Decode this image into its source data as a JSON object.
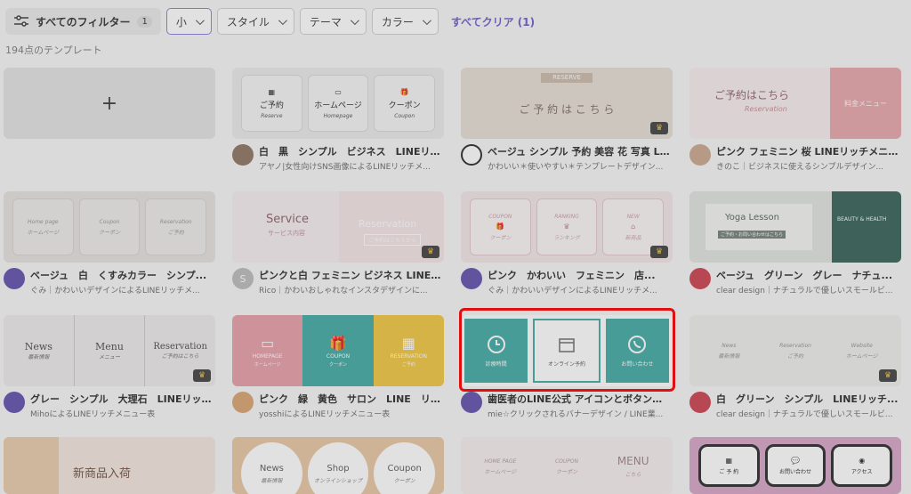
{
  "filters": {
    "all_label": "すべてのフィルター",
    "all_count": "1",
    "chips": [
      {
        "label": "小",
        "selected": true
      },
      {
        "label": "スタイル",
        "selected": false
      },
      {
        "label": "テーマ",
        "selected": false
      },
      {
        "label": "カラー",
        "selected": false
      }
    ],
    "clear_label": "すべてクリア (1)"
  },
  "result_count": "194点のテンプレート",
  "add_symbol": "+",
  "cards": [
    {
      "title": "白　黒　シンプル　ビジネス　LINEリ...",
      "author": "アヤノ|女性向けSNS画像によるLINEリッチメ...",
      "thumb": {
        "items": [
          "ご予約",
          "ホームページ",
          "クーポン"
        ],
        "subs": [
          "Reserve",
          "Homepage",
          "Coupon"
        ]
      }
    },
    {
      "title": "ベージュ シンプル 予約 美容 花 写真 LIN...",
      "author": "かわいい＊使いやすい＊テンプレートデザイン...",
      "thumb": {
        "banner": "RESERVE",
        "text": "ご 予 約 は こ ち ら"
      }
    },
    {
      "title": "ピンク フェミニン 桜 LINEリッチメニ...",
      "author": "きのこ｜ビジネスに使えるシンプルデザイン...",
      "thumb": {
        "text": "ご予約はこちら",
        "sub": "Reservation",
        "side": "料金メニュー"
      }
    },
    {
      "title": "ベージュ　白　くすみカラー　シンプ...",
      "author": "ぐみ｜かわいいデザインによるLINEリッチメ...",
      "thumb": {
        "items": [
          "Home page",
          "Coupon",
          "Reservation"
        ],
        "subs": [
          "ホームページ",
          "クーポン",
          "ご予約"
        ]
      }
    },
    {
      "title": "ピンクと白 フェミニン ビジネス LINE...",
      "author": "Rico｜かわいおしゃれなインスタデザインに...",
      "thumb": {
        "left": "Service",
        "left_sub": "サービス内容",
        "right": "Reservation",
        "right_sub": "ご予約はこちらから"
      }
    },
    {
      "title": "ピンク　かわいい　フェミニン　店...",
      "author": "ぐみ｜かわいいデザインによるLINEリッチメ...",
      "thumb": {
        "items": [
          "COUPON",
          "RANKING",
          "NEW"
        ],
        "subs": [
          "クーポン",
          "ランキング",
          "新商品"
        ]
      }
    },
    {
      "title": "ベージュ　グリーン　グレー　ナチュ...",
      "author": "clear design｜ナチュラルで優しいスモールビ...",
      "thumb": {
        "left": "Yoga Lesson",
        "left_sub": "ご予約・お問い合わせはこちら",
        "right": "BEAUTY & HEALTH"
      }
    },
    {
      "title": "グレー　シンプル　大理石　LINEリッ...",
      "author": "MihoによるLINEリッチメニュー表",
      "thumb": {
        "items": [
          "News",
          "Menu",
          "Reservation"
        ],
        "subs": [
          "最新情報",
          "メニュー",
          "ご予約はこちら"
        ]
      }
    },
    {
      "title": "ピンク　緑　黄色　サロン　LINE　リ...",
      "author": "yosshiによるLINEリッチメニュー表",
      "thumb": {
        "items": [
          "HOMEPAGE",
          "COUPON",
          "RESERVATION"
        ],
        "subs": [
          "ホームページ",
          "クーポン",
          "ご予約"
        ]
      }
    },
    {
      "title": "歯医者のLINE公式 アイコンとボタンの...",
      "author": "mie☆クリックされるバナーデザイン / LINE業...",
      "thumb": {
        "items": [
          "診療時間",
          "オンライン予約",
          "お問い合わせ"
        ]
      }
    },
    {
      "title": "白　グリーン　シンプル　LINEリッチ...",
      "author": "clear design｜ナチュラルで優しいスモールビ...",
      "thumb": {
        "items": [
          "News",
          "Reservation",
          "Website"
        ],
        "subs": [
          "最新情報",
          "ご予約",
          "ホームページ"
        ]
      }
    },
    {
      "title": "",
      "author": "",
      "thumb": {
        "text": "新商品入荷"
      }
    },
    {
      "title": "",
      "author": "",
      "thumb": {
        "items": [
          "News",
          "Shop",
          "Coupon"
        ],
        "subs": [
          "最新情報",
          "オンラインショップ",
          "クーポン"
        ]
      }
    },
    {
      "title": "",
      "author": "",
      "thumb": {
        "items": [
          "HOME PAGE",
          "COUPON",
          "MENU"
        ],
        "subs": [
          "ホームページ",
          "クーポン",
          "こちら"
        ]
      }
    },
    {
      "title": "",
      "author": "",
      "thumb": {
        "items": [
          "ご 予 約",
          "お問い合わせ",
          "アクセス"
        ]
      }
    }
  ],
  "colors": {
    "accent": "#6a55c8",
    "highlight": "#e01010",
    "teal": "#3aa7a0"
  }
}
